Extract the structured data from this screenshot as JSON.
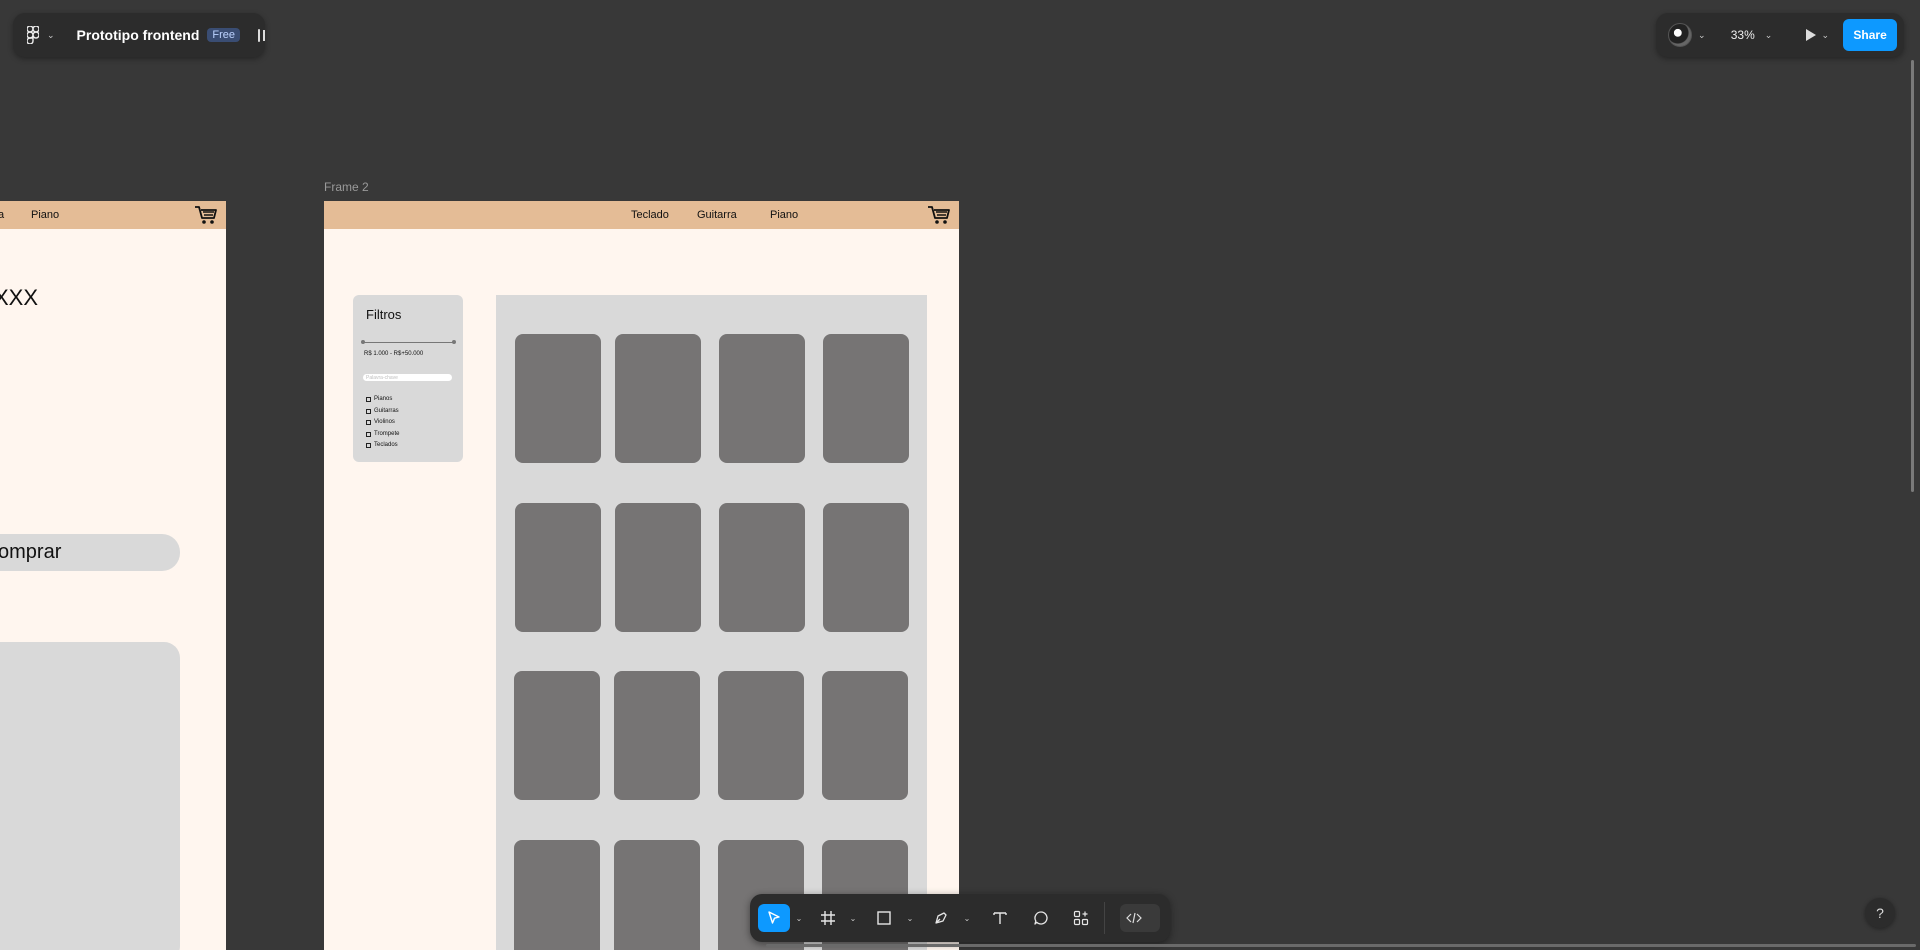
{
  "app": {
    "file_title": "Prototipo frontend",
    "plan_badge": "Free",
    "zoom_level": "33%",
    "share_label": "Share",
    "help_label": "?"
  },
  "canvas": {
    "frame2_label": "Frame 2"
  },
  "frame1": {
    "nav": [
      "a",
      "Piano"
    ],
    "title": "XXX",
    "buy_label": "omprar"
  },
  "frame2": {
    "nav": [
      "Teclado",
      "Guitarra",
      "Piano"
    ],
    "filters": {
      "title": "Filtros",
      "price_range": "R$ 1.000 - R$+50.000",
      "keyword_placeholder": "Palavra-chave",
      "categories": [
        "Pianos",
        "Guitarras",
        "Violinos",
        "Trompete",
        "Teclados"
      ]
    },
    "product_card_count": 16
  },
  "toolbar": {
    "tools": [
      "move-tool",
      "frame-tool",
      "shape-tool",
      "pen-tool",
      "text-tool",
      "comment-tool",
      "actions-tool",
      "dev-mode-toggle"
    ]
  },
  "colors": {
    "canvas": "#383838",
    "frame_bg": "#fff6ef",
    "navbar": "#e4bc96",
    "placeholder_block": "#d9d9d9",
    "card": "#767474",
    "accent": "#0d99ff"
  }
}
